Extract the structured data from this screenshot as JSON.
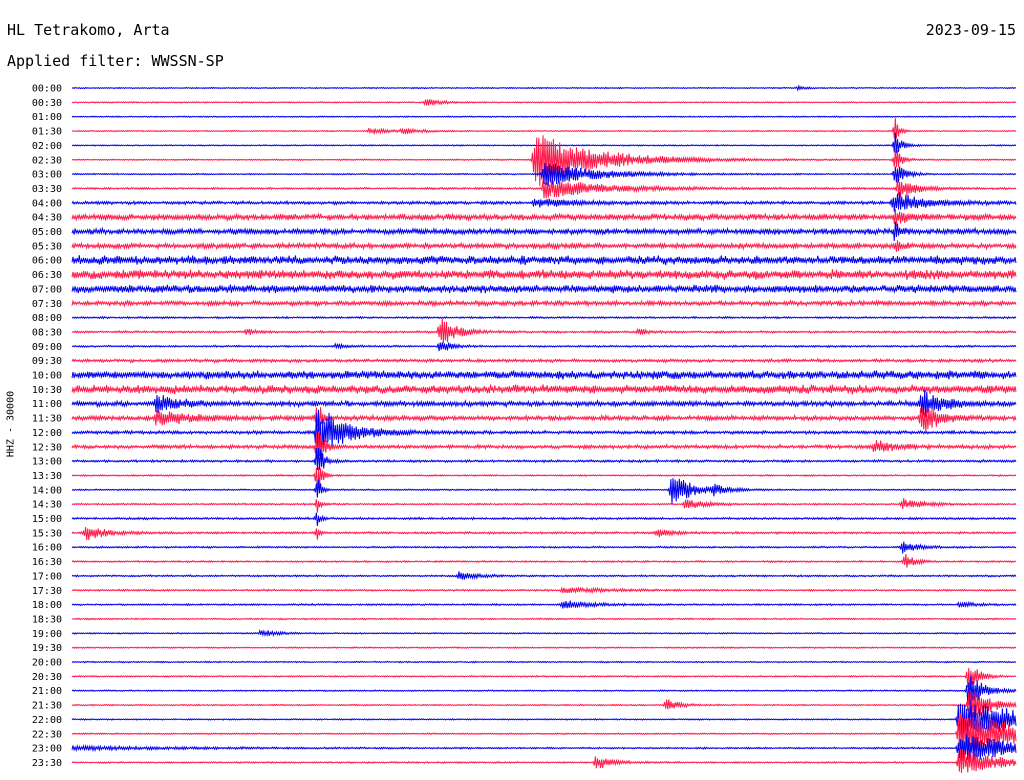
{
  "header": {
    "station": "HL Tetrakomo, Arta",
    "date": "2023-09-15",
    "filter_text": "Applied filter: WWSSN-SP"
  },
  "axis": {
    "ylabel": "HHZ - 30000"
  },
  "colors": {
    "trace_a": "#0000ee",
    "trace_b": "#ff1a4a",
    "text": "#000000",
    "background": "#ffffff"
  },
  "chart_data": {
    "type": "line",
    "ylabel": "HHZ - 30000",
    "xlabel": "",
    "rows_per_day": 48,
    "row_minutes": 30,
    "color_cycle": [
      "#0000ee",
      "#ff1a4a"
    ],
    "rows": [
      {
        "label": "00:00",
        "noise": 0.25
      },
      {
        "label": "00:30",
        "noise": 0.25
      },
      {
        "label": "01:00",
        "noise": 0.25
      },
      {
        "label": "01:30",
        "noise": 0.25
      },
      {
        "label": "02:00",
        "noise": 0.25
      },
      {
        "label": "02:30",
        "noise": 0.25
      },
      {
        "label": "03:00",
        "noise": 0.3
      },
      {
        "label": "03:30",
        "noise": 0.5
      },
      {
        "label": "04:00",
        "noise": 1.0
      },
      {
        "label": "04:30",
        "noise": 2.2
      },
      {
        "label": "05:00",
        "noise": 2.0
      },
      {
        "label": "05:30",
        "noise": 1.8
      },
      {
        "label": "06:00",
        "noise": 3.2
      },
      {
        "label": "06:30",
        "noise": 3.4
      },
      {
        "label": "07:00",
        "noise": 2.8
      },
      {
        "label": "07:30",
        "noise": 1.6
      },
      {
        "label": "08:00",
        "noise": 0.5
      },
      {
        "label": "08:30",
        "noise": 0.6
      },
      {
        "label": "09:00",
        "noise": 0.5
      },
      {
        "label": "09:30",
        "noise": 1.0
      },
      {
        "label": "10:00",
        "noise": 3.0
      },
      {
        "label": "10:30",
        "noise": 3.2
      },
      {
        "label": "11:00",
        "noise": 1.8
      },
      {
        "label": "11:30",
        "noise": 1.6
      },
      {
        "label": "12:00",
        "noise": 1.0
      },
      {
        "label": "12:30",
        "noise": 1.2
      },
      {
        "label": "13:00",
        "noise": 0.7
      },
      {
        "label": "13:30",
        "noise": 0.35
      },
      {
        "label": "14:00",
        "noise": 0.35
      },
      {
        "label": "14:30",
        "noise": 0.4
      },
      {
        "label": "15:00",
        "noise": 0.6
      },
      {
        "label": "15:30",
        "noise": 0.6
      },
      {
        "label": "16:00",
        "noise": 0.45
      },
      {
        "label": "16:30",
        "noise": 0.4
      },
      {
        "label": "17:00",
        "noise": 0.45
      },
      {
        "label": "17:30",
        "noise": 0.45
      },
      {
        "label": "18:00",
        "noise": 0.45
      },
      {
        "label": "18:30",
        "noise": 0.35
      },
      {
        "label": "19:00",
        "noise": 0.3
      },
      {
        "label": "19:30",
        "noise": 0.3
      },
      {
        "label": "20:00",
        "noise": 0.3
      },
      {
        "label": "20:30",
        "noise": 0.35
      },
      {
        "label": "21:00",
        "noise": 0.3
      },
      {
        "label": "21:30",
        "noise": 0.3
      },
      {
        "label": "22:00",
        "noise": 0.3
      },
      {
        "label": "22:30",
        "noise": 0.3
      },
      {
        "label": "23:00",
        "noise": 0.4
      },
      {
        "label": "23:30",
        "noise": 0.4
      }
    ],
    "events": [
      {
        "row": 0,
        "t": 0.77,
        "amp": 3,
        "dur": 0.006
      },
      {
        "row": 1,
        "t": 0.375,
        "amp": 5,
        "dur": 0.012
      },
      {
        "row": 3,
        "t": 0.315,
        "amp": 3,
        "dur": 0.02
      },
      {
        "row": 3,
        "t": 0.35,
        "amp": 2.5,
        "dur": 0.02
      },
      {
        "row": 5,
        "t": 0.49,
        "amp": 30,
        "dur": 0.06
      },
      {
        "row": 6,
        "t": 0.5,
        "amp": 14,
        "dur": 0.05
      },
      {
        "row": 7,
        "t": 0.5,
        "amp": 10,
        "dur": 0.06
      },
      {
        "row": 8,
        "t": 0.49,
        "amp": 4,
        "dur": 0.04
      },
      {
        "row": 3,
        "t": 0.872,
        "amp": 14,
        "dur": 0.004
      },
      {
        "row": 4,
        "t": 0.872,
        "amp": 16,
        "dur": 0.006
      },
      {
        "row": 5,
        "t": 0.872,
        "amp": 14,
        "dur": 0.006
      },
      {
        "row": 6,
        "t": 0.872,
        "amp": 12,
        "dur": 0.01
      },
      {
        "row": 7,
        "t": 0.875,
        "amp": 10,
        "dur": 0.02
      },
      {
        "row": 8,
        "t": 0.87,
        "amp": 12,
        "dur": 0.03
      },
      {
        "row": 9,
        "t": 0.872,
        "amp": 8,
        "dur": 0.01
      },
      {
        "row": 10,
        "t": 0.872,
        "amp": 10,
        "dur": 0.006
      },
      {
        "row": 11,
        "t": 0.872,
        "amp": 6,
        "dur": 0.006
      },
      {
        "row": 17,
        "t": 0.39,
        "amp": 18,
        "dur": 0.015
      },
      {
        "row": 18,
        "t": 0.39,
        "amp": 8,
        "dur": 0.01
      },
      {
        "row": 17,
        "t": 0.185,
        "amp": 3,
        "dur": 0.01
      },
      {
        "row": 18,
        "t": 0.28,
        "amp": 3,
        "dur": 0.008
      },
      {
        "row": 17,
        "t": 0.6,
        "amp": 3,
        "dur": 0.01
      },
      {
        "row": 24,
        "t": 0.26,
        "amp": 34,
        "dur": 0.004
      },
      {
        "row": 23,
        "t": 0.26,
        "amp": 20,
        "dur": 0.004
      },
      {
        "row": 25,
        "t": 0.26,
        "amp": 26,
        "dur": 0.006
      },
      {
        "row": 26,
        "t": 0.26,
        "amp": 20,
        "dur": 0.006
      },
      {
        "row": 27,
        "t": 0.26,
        "amp": 24,
        "dur": 0.004
      },
      {
        "row": 28,
        "t": 0.26,
        "amp": 14,
        "dur": 0.004
      },
      {
        "row": 29,
        "t": 0.26,
        "amp": 8,
        "dur": 0.003
      },
      {
        "row": 30,
        "t": 0.26,
        "amp": 8,
        "dur": 0.003
      },
      {
        "row": 31,
        "t": 0.26,
        "amp": 6,
        "dur": 0.003
      },
      {
        "row": 24,
        "t": 0.265,
        "amp": 22,
        "dur": 0.03
      },
      {
        "row": 22,
        "t": 0.09,
        "amp": 10,
        "dur": 0.02
      },
      {
        "row": 23,
        "t": 0.09,
        "amp": 8,
        "dur": 0.03
      },
      {
        "row": 22,
        "t": 0.9,
        "amp": 14,
        "dur": 0.02
      },
      {
        "row": 23,
        "t": 0.9,
        "amp": 18,
        "dur": 0.015
      },
      {
        "row": 25,
        "t": 0.85,
        "amp": 6,
        "dur": 0.02
      },
      {
        "row": 28,
        "t": 0.635,
        "amp": 18,
        "dur": 0.02
      },
      {
        "row": 29,
        "t": 0.65,
        "amp": 5,
        "dur": 0.02
      },
      {
        "row": 28,
        "t": 0.68,
        "amp": 4,
        "dur": 0.015
      },
      {
        "row": 29,
        "t": 0.88,
        "amp": 6,
        "dur": 0.02
      },
      {
        "row": 31,
        "t": 0.015,
        "amp": 8,
        "dur": 0.02
      },
      {
        "row": 31,
        "t": 0.62,
        "amp": 4,
        "dur": 0.015
      },
      {
        "row": 32,
        "t": 0.88,
        "amp": 6,
        "dur": 0.015
      },
      {
        "row": 33,
        "t": 0.882,
        "amp": 8,
        "dur": 0.01
      },
      {
        "row": 34,
        "t": 0.41,
        "amp": 4,
        "dur": 0.02
      },
      {
        "row": 35,
        "t": 0.52,
        "amp": 3,
        "dur": 0.04
      },
      {
        "row": 36,
        "t": 0.52,
        "amp": 4,
        "dur": 0.03
      },
      {
        "row": 36,
        "t": 0.94,
        "amp": 3,
        "dur": 0.015
      },
      {
        "row": 38,
        "t": 0.2,
        "amp": 4,
        "dur": 0.015
      },
      {
        "row": 43,
        "t": 0.63,
        "amp": 8,
        "dur": 0.012
      },
      {
        "row": 44,
        "t": 0.94,
        "amp": 22,
        "dur": 0.07
      },
      {
        "row": 45,
        "t": 0.94,
        "amp": 26,
        "dur": 0.06
      },
      {
        "row": 46,
        "t": 0.94,
        "amp": 18,
        "dur": 0.05
      },
      {
        "row": 47,
        "t": 0.94,
        "amp": 14,
        "dur": 0.04
      },
      {
        "row": 41,
        "t": 0.95,
        "amp": 16,
        "dur": 0.01
      },
      {
        "row": 42,
        "t": 0.95,
        "amp": 18,
        "dur": 0.015
      },
      {
        "row": 43,
        "t": 0.95,
        "amp": 20,
        "dur": 0.02
      },
      {
        "row": 47,
        "t": 0.555,
        "amp": 8,
        "dur": 0.015
      },
      {
        "row": 46,
        "t": 0.0,
        "amp": 2,
        "dur": 0.1
      }
    ]
  }
}
